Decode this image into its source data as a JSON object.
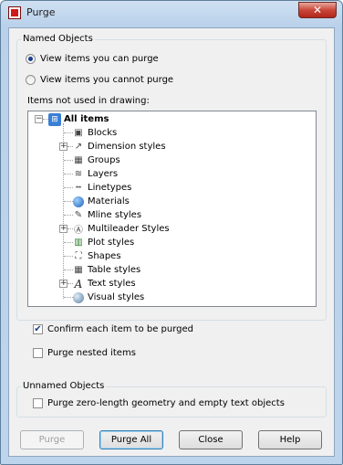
{
  "window": {
    "title": "Purge",
    "close_glyph": "✕"
  },
  "named_objects": {
    "label": "Named Objects",
    "radio_can": "View items you can purge",
    "radio_cannot": "View items you cannot purge",
    "selected": "can"
  },
  "tree": {
    "label": "Items not used in drawing:",
    "root": "All items",
    "items": [
      {
        "label": "Blocks",
        "icon": "blocks-icon"
      },
      {
        "label": "Dimension styles",
        "icon": "dimension-styles-icon"
      },
      {
        "label": "Groups",
        "icon": "groups-icon"
      },
      {
        "label": "Layers",
        "icon": "layers-icon"
      },
      {
        "label": "Linetypes",
        "icon": "linetypes-icon"
      },
      {
        "label": "Materials",
        "icon": "materials-icon"
      },
      {
        "label": "Mline styles",
        "icon": "mline-styles-icon"
      },
      {
        "label": "Multileader Styles",
        "icon": "multileader-styles-icon"
      },
      {
        "label": "Plot styles",
        "icon": "plot-styles-icon"
      },
      {
        "label": "Shapes",
        "icon": "shapes-icon"
      },
      {
        "label": "Table styles",
        "icon": "table-styles-icon"
      },
      {
        "label": "Text styles",
        "icon": "text-styles-icon"
      },
      {
        "label": "Visual styles",
        "icon": "visual-styles-icon"
      }
    ]
  },
  "options": {
    "confirm": "Confirm each item to be purged",
    "confirm_checked": true,
    "nested": "Purge nested items",
    "nested_checked": false
  },
  "unnamed_objects": {
    "label": "Unnamed Objects",
    "zero_length": "Purge zero-length geometry and empty text objects",
    "zero_length_checked": false
  },
  "buttons": {
    "purge": "Purge",
    "purge_all": "Purge All",
    "close": "Close",
    "help": "Help"
  },
  "colors": {
    "accent": "#1a3d8f",
    "title_bar": "#b9d1ea",
    "close_red": "#c9473a"
  }
}
